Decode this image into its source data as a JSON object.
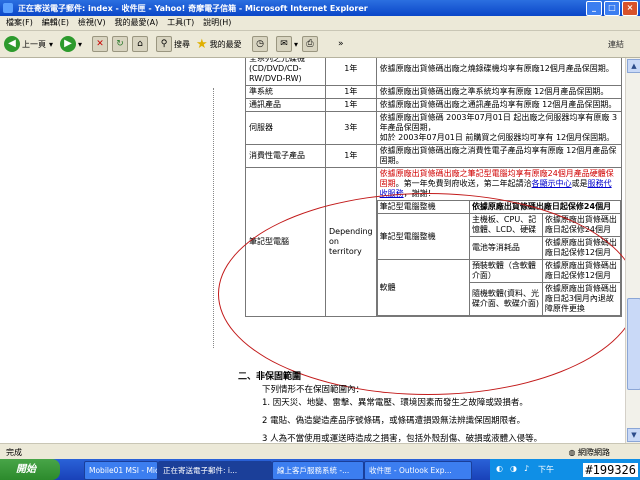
{
  "window": {
    "title": "正在寄送電子郵件: index - 收件匣 - Yahoo! 奇摩電子信箱 - Microsoft Internet Explorer"
  },
  "menu": [
    "檔案(F)",
    "編輯(E)",
    "檢視(V)",
    "我的最愛(A)",
    "工具(T)",
    "說明(H)"
  ],
  "toolbar": {
    "back": "上一頁",
    "search": "搜尋",
    "favorites": "我的最愛",
    "links": "連結"
  },
  "table": {
    "rows": [
      {
        "name": "全系列之光碟機 (CD/DVD/CD-RW/DVD-RW)",
        "term": "1年",
        "desc": "依據原廠出貨條碼出廠之燒錄碟機均享有原廠12個月產品保固期。"
      },
      {
        "name": "準系統",
        "term": "1年",
        "desc": "依據原廠出貨條碼出廠之準系統均享有原廠 12個月產品保固期。"
      },
      {
        "name": "通訊產品",
        "term": "1年",
        "desc": "依據原廠出貨條碼出廠之通訊產品均享有原廠 12個月產品保固期。"
      },
      {
        "name": "伺服器",
        "term": "3年",
        "desc1": "依據原廠出貨條碼 2003年07月01日 起出廠之伺服器均享有原廠 3年產品保固期，",
        "desc2": "如於 2003年07月01日 前購買之伺服器均可享有 12個月保固期。"
      },
      {
        "name": "消費性電子產品",
        "term": "1年",
        "desc": "依據原廠出貨條碼出廠之消費性電子產品均享有原廠 12個月產品保固期。"
      }
    ],
    "notebook": {
      "name": "筆記型電腦",
      "term": "Depending on territory",
      "note_red": "依據原廠出貨條碼出廠之筆記型電腦均享有原廠24個月產品硬體保固期",
      "note_mid": "。第一年免費到府收送，第二年起請洽",
      "note_link1": "各顯示中心",
      "note_or": "或是",
      "note_link2": "服務代收服務",
      "note_end": "，謝謝！",
      "hdr_left": "筆記型電腦整機",
      "hdr_right": "依據原廠出貨條碼出廠日起保修24個月",
      "hw_label": "筆記型電腦整機",
      "hw_parts": "主機板、CPU、記憶體、LCD、硬碟",
      "hw_warranty": "依據原廠出貨條碼出廠日起保修24個月",
      "consumable": "電池等消耗品",
      "consumable_warranty": "依據原廠出貨條碼出廠日起保修12個月",
      "sw_label": "軟體",
      "sw1": "預裝軟體（含軟體介面）",
      "sw1_warranty": "依據原廠出貨條碼出廠日起保修12個月",
      "sw2": "隨機軟體(資料、光碟介面、軟碟介面)",
      "sw2_warranty": "依據原廠出貨條碼出廠日起3個月內退故障原件更換"
    }
  },
  "section": {
    "title": "二、非保固範圍",
    "intro": "下列情形不在保固範圍內：",
    "item1": "1. 因天災、地變、雷擊、異常電壓、環境因素而發生之故障或毀損者。",
    "item2": "2 電貼、偽造變造產品序號條碼，或條碼遭損毀無法辨識保固期限者。",
    "item3": "3 人為不當使用或運送時造成之損害，包括外殼刮傷、破損或液體入侵等。"
  },
  "status": {
    "left": "完成",
    "right": "網際網路"
  },
  "taskbar": {
    "start": "開始",
    "tasks": [
      "Mobile01 MSI - Micro...",
      "正在寄送電子郵件: i...",
      "線上客戶服務系統 -...",
      "收件匣 - Outlook Exp..."
    ],
    "clock": "下午"
  },
  "stamp": "#199326"
}
